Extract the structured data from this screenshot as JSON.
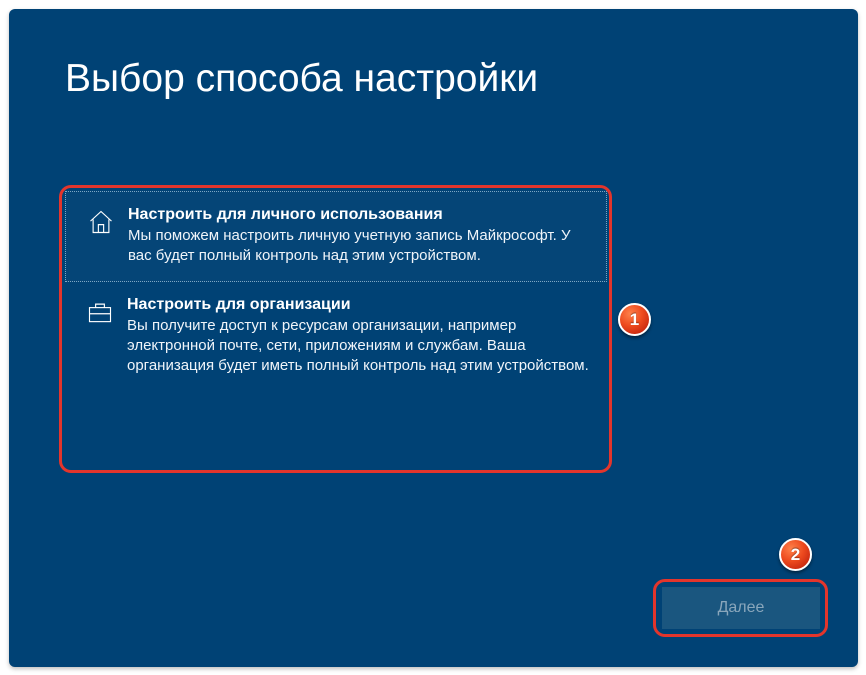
{
  "heading": "Выбор способа настройки",
  "options": [
    {
      "icon": "home-icon",
      "title": "Настроить для личного использования",
      "desc": "Мы поможем настроить личную учетную запись Майкрософт. У вас будет полный контроль над этим устройством."
    },
    {
      "icon": "briefcase-icon",
      "title": "Настроить для организации",
      "desc": "Вы получите доступ к ресурсам организации, например электронной почте, сети, приложениям и службам. Ваша организация будет иметь полный контроль над этим устройством."
    }
  ],
  "next_label": "Далее",
  "annotations": {
    "badge1": "1",
    "badge2": "2"
  },
  "colors": {
    "background": "#004275",
    "accent_red": "#e3352c"
  }
}
